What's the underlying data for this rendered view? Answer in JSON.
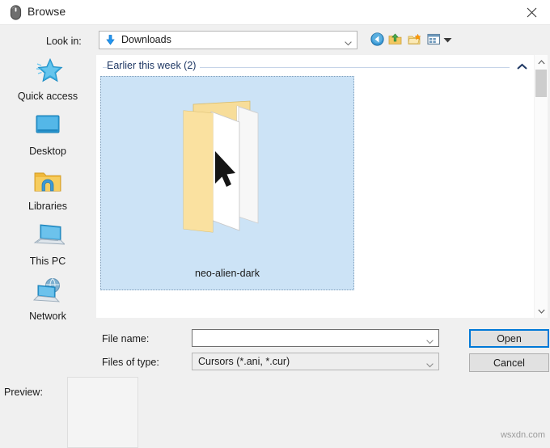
{
  "window": {
    "title": "Browse",
    "title_icon": "mouse-icon",
    "close_icon": "close-icon"
  },
  "lookin": {
    "label": "Look in:",
    "value": "Downloads",
    "value_icon": "downloads-arrow-icon",
    "dropdown_icon": "chevron-down-icon"
  },
  "toolbar": {
    "items": [
      {
        "icon": "back-navigation-icon",
        "title": "Back"
      },
      {
        "icon": "up-one-level-folder-icon",
        "title": "Up one level"
      },
      {
        "icon": "create-new-folder-icon",
        "title": "Create New Folder"
      },
      {
        "icon": "views-icon",
        "title": "Views"
      }
    ],
    "views_dropdown_icon": "chevron-down-icon"
  },
  "file_list": {
    "group": {
      "label": "Earlier this week (2)",
      "collapse_icon": "chevron-up-icon"
    },
    "items": [
      {
        "name": "neo-alien-dark",
        "selected": true,
        "thumbnail": "open-folder-with-cursor-thumbnail"
      }
    ],
    "scrollbar": {
      "up_icon": "chevron-up-icon",
      "down_icon": "chevron-down-icon"
    }
  },
  "places": {
    "items": [
      {
        "label": "Quick access",
        "icon": "quick-access-star-icon"
      },
      {
        "label": "Desktop",
        "icon": "desktop-monitor-icon"
      },
      {
        "label": "Libraries",
        "icon": "libraries-folder-icon"
      },
      {
        "label": "This PC",
        "icon": "this-pc-computer-icon"
      },
      {
        "label": "Network",
        "icon": "network-globe-icon"
      }
    ]
  },
  "form": {
    "filename_label": "File name:",
    "filename_value": "",
    "filename_placeholder": "",
    "filetype_label": "Files of type:",
    "filetype_value": "Cursors (*.ani, *.cur)",
    "open_label": "Open",
    "cancel_label": "Cancel"
  },
  "preview": {
    "label": "Preview:",
    "content": ""
  },
  "watermark": "wsxdn.com",
  "colors": {
    "selection_blue": "#cce3f6",
    "focus_blue": "#0078d7",
    "group_header_text": "#1f3864",
    "window_bg": "#f0f0f0"
  }
}
